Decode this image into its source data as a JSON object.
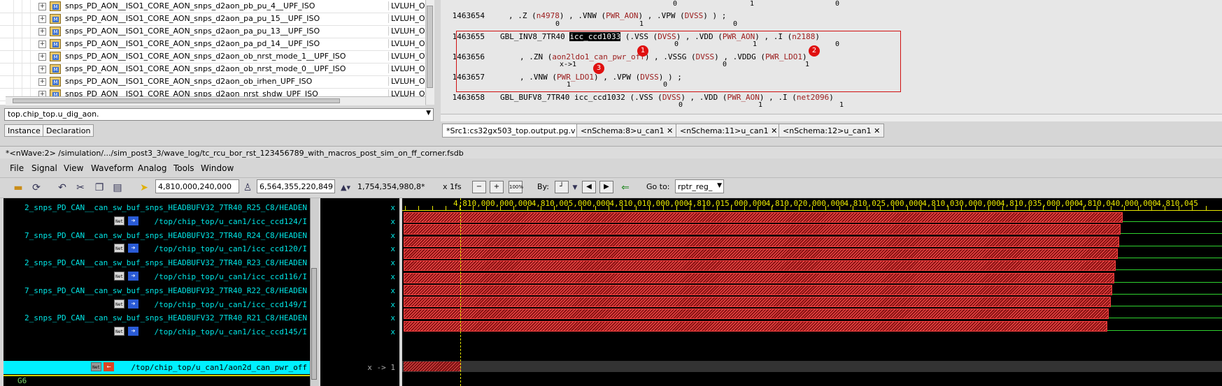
{
  "hierarchy": {
    "rows": [
      {
        "name": "snps_PD_AON__ISO1_CORE_AON_snps_d2aon_pb_pu_4__UPF_ISO",
        "cell": "LVLUH_OI"
      },
      {
        "name": "snps_PD_AON__ISO1_CORE_AON_snps_d2aon_pa_pu_15__UPF_ISO",
        "cell": "LVLUH_OI"
      },
      {
        "name": "snps_PD_AON__ISO1_CORE_AON_snps_d2aon_pa_pu_13__UPF_ISO",
        "cell": "LVLUH_OI"
      },
      {
        "name": "snps_PD_AON__ISO1_CORE_AON_snps_d2aon_pa_pd_14__UPF_ISO",
        "cell": "LVLUH_OI"
      },
      {
        "name": "snps_PD_AON__ISO1_CORE_AON_snps_d2aon_ob_nrst_mode_1__UPF_ISO",
        "cell": "LVLUH_OI"
      },
      {
        "name": "snps_PD_AON__ISO1_CORE_AON_snps_d2aon_ob_nrst_mode_0__UPF_ISO",
        "cell": "LVLUH_OI"
      },
      {
        "name": "snps_PD_AON__ISO1_CORE_AON_snps_d2aon_ob_irhen_UPF_ISO",
        "cell": "LVLUH_OI"
      },
      {
        "name": "snps_PD_AON__ISO1_CORE_AON_snps_d2aon_nrst_shdw_UPF_ISO",
        "cell": "LVLUH_OI"
      }
    ],
    "expand_glyph": "+",
    "scope_value": "top.chip_top.u_dig_aon.",
    "tabs": [
      "Instance",
      "Declaration"
    ]
  },
  "source": {
    "lines": [
      {
        "num": "1463654",
        "parts": [
          ", .Z (",
          "n4978",
          ") , .VNW (",
          "PWR_AON",
          ") , .VPW (",
          "DVSS",
          ") ) ;"
        ],
        "subs": [
          "0",
          "1",
          "0"
        ],
        "above_subs": [
          "0",
          "1",
          "0"
        ]
      },
      {
        "num": "1463655",
        "cell": "GBL_INV8_7TR40",
        "inst": "icc_ccd1033",
        "rest": [
          " (.VSS (",
          "DVSS",
          ") , .VDD (",
          "PWR_AON",
          ") , .I (",
          "n2188",
          ")"
        ],
        "subs": [
          "0",
          "1",
          "0"
        ]
      },
      {
        "num": "1463656",
        "parts": [
          ", .ZN (",
          "aon2ldo1_can_pwr_off",
          ") , .VSSG (",
          "DVSS",
          ") , .VDDG (",
          "PWR_LDO1",
          ")"
        ],
        "subs": [
          "x->1",
          "0",
          "1"
        ]
      },
      {
        "num": "1463657",
        "parts": [
          ", .VNW (",
          "PWR_LDO1",
          ") , .VPW (",
          "DVSS",
          ") ) ;"
        ],
        "subs": [
          "1",
          "0"
        ]
      },
      {
        "num": "1463658",
        "cell": "GBL_BUFV8_7TR40",
        "inst": "icc_ccd1032",
        "rest": [
          " (.VSS (",
          "DVSS",
          ") , .VDD (",
          "PWR_AON",
          ") , .I (",
          "net2096",
          ")"
        ],
        "subs": [
          "0",
          "1",
          "1"
        ]
      }
    ],
    "badges": [
      "1",
      "2",
      "3"
    ],
    "tabs": [
      "*Src1:cs32gx503_top.output.pg.v",
      "<nSchema:8>u_can1",
      "<nSchema:11>u_can1",
      "<nSchema:12>u_can1"
    ],
    "tab_close": "✕"
  },
  "nwave": {
    "title": "*<nWave:2> /simulation/.../sim_post3_3/wave_log/tc_rcu_bor_rst_123456789_with_macros_post_sim_on_ff_corner.fsdb",
    "menu": [
      "File",
      "Signal",
      "View",
      "Waveform",
      "Analog",
      "Tools",
      "Window"
    ],
    "toolbar": {
      "cursor_time": "4,810,000,240,000",
      "marker_time": "6,564,355,220,849",
      "delta": "1,754,354,980,8*",
      "scale": "x 1fs",
      "by_label": "By:",
      "goto_label": "Go to:",
      "goto_value": "rptr_reg_"
    },
    "signals": [
      {
        "text": "2_snps_PD_CAN__can_sw_buf_snps_HEADBUFV32_7TR40_R25_C8/HEADEN",
        "kind": "inst"
      },
      {
        "text": "/top/chip_top/u_can1/icc_ccd124/I",
        "kind": "net"
      },
      {
        "text": "7_snps_PD_CAN__can_sw_buf_snps_HEADBUFV32_7TR40_R24_C8/HEADEN",
        "kind": "inst"
      },
      {
        "text": "/top/chip_top/u_can1/icc_ccd120/I",
        "kind": "net"
      },
      {
        "text": "2_snps_PD_CAN__can_sw_buf_snps_HEADBUFV32_7TR40_R23_C8/HEADEN",
        "kind": "inst"
      },
      {
        "text": "/top/chip_top/u_can1/icc_ccd116/I",
        "kind": "net"
      },
      {
        "text": "7_snps_PD_CAN__can_sw_buf_snps_HEADBUFV32_7TR40_R22_C8/HEADEN",
        "kind": "inst"
      },
      {
        "text": "/top/chip_top/u_can1/icc_ccd149/I",
        "kind": "net"
      },
      {
        "text": "2_snps_PD_CAN__can_sw_buf_snps_HEADBUFV32_7TR40_R21_C8/HEADEN",
        "kind": "inst"
      },
      {
        "text": "/top/chip_top/u_can1/icc_ccd145/I",
        "kind": "net"
      },
      {
        "text": "/top/chip_top/u_can1/aon2d_can_pwr_off",
        "kind": "selected"
      }
    ],
    "values": [
      "x",
      "x",
      "x",
      "x",
      "x",
      "x",
      "x",
      "x",
      "x",
      "x",
      "x -> 1"
    ],
    "group_label": "G6",
    "ruler_labels": [
      "4,810,000,000,000",
      "4,810,005,000,000",
      "4,810,010,000,000",
      "4,810,015,000,000",
      "4,810,020,000,000",
      "4,810,025,000,000",
      "4,810,030,000,000",
      "4,810,035,000,000",
      "4,810,040,000,000",
      "4,810,045"
    ],
    "colors": {
      "unknown_x": "#ff4040",
      "low": "#2fd12f",
      "selected_row": "#00f0ff",
      "ruler": "#e8e800"
    }
  }
}
